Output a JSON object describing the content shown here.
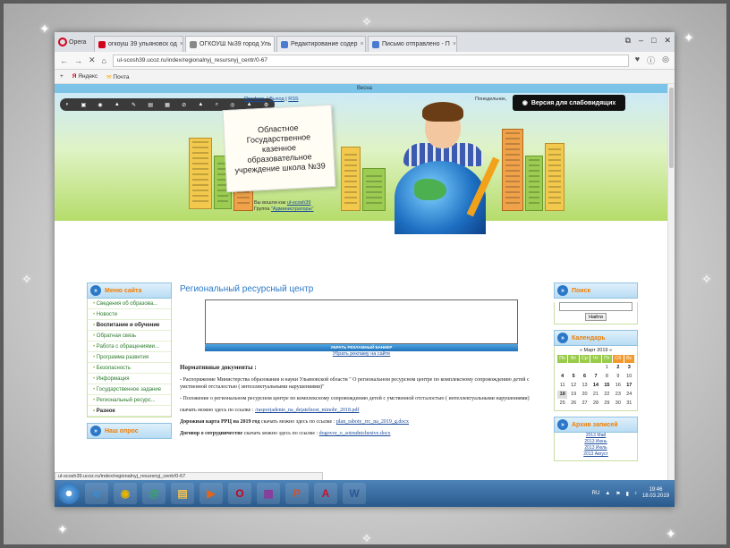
{
  "browser": {
    "menu_label": "Opera",
    "tabs": [
      {
        "label": "огкоуш 39 ульяновск од",
        "color": "#d0021b",
        "active": false
      },
      {
        "label": "ОГКОУШ №39 город Уль",
        "color": "#888888",
        "active": true
      },
      {
        "label": "Редактирование содер",
        "color": "#4a7bd0",
        "active": false
      },
      {
        "label": "Письмо отправлено - П",
        "color": "#4a7bd0",
        "active": false
      }
    ],
    "tab_close": "×",
    "window_controls": [
      "⧉",
      "–",
      "□",
      "✕"
    ],
    "nav": {
      "back": "←",
      "forward": "→",
      "stop": "✕",
      "home": "⌂"
    },
    "url": "ul-scosh39.ucoz.ru/index/regionalnyj_resursnyj_centr/0-67",
    "addr_icons": [
      "♥",
      "ⓘ",
      "◎"
    ],
    "bookmarks": [
      {
        "label": "Яндекс",
        "icon": "Я"
      },
      {
        "label": "Почта",
        "icon": "✉"
      }
    ],
    "status_url": "ul-scosh39.ucoz.ru/index/regionalnyj_resursnyj_centr/0-67"
  },
  "site": {
    "top_strip": "Весна",
    "toolbar_icons": [
      "◐",
      "▣",
      "◉",
      "▲",
      "✎",
      "▤",
      "▦",
      "⊘",
      "▲",
      "⌕",
      "◎",
      "▲",
      "⚙"
    ],
    "login_links": [
      "Профиль",
      "Выход",
      "RSS"
    ],
    "greeting": "Понедельник,",
    "impaired_label": "Версия для слабовидящих",
    "impaired_icon": "◉",
    "school_name": "Областное Государственное казенное образовательное учреждение школа №39",
    "logged_in_prefix": "Вы вошли как",
    "logged_in_user": "ul-scosh39",
    "group_prefix": "Группа",
    "group_name": "\"Администраторы\""
  },
  "left_menu": {
    "title": "Меню сайта",
    "items": [
      {
        "label": "Сведения об образова...",
        "dark": false
      },
      {
        "label": "Новости",
        "dark": false
      },
      {
        "label": "Воспитание и обучение",
        "dark": true
      },
      {
        "label": "Обратная связь",
        "dark": false
      },
      {
        "label": "Работа с обращениями...",
        "dark": false
      },
      {
        "label": "Программа развития",
        "dark": false
      },
      {
        "label": "Безопасность",
        "dark": false
      },
      {
        "label": "Информация",
        "dark": false
      },
      {
        "label": "Государственное задание",
        "dark": false
      },
      {
        "label": "Региональный ресурс...",
        "dark": false
      },
      {
        "label": "Разное",
        "dark": true
      }
    ],
    "poll_title": "Наш опрос"
  },
  "content": {
    "title": "Региональный ресурсный центр",
    "ad_button": "УБРАТЬ РЕКЛАМНЫЙ БАННЕР",
    "ad_link": "Убрать рекламу на сайте",
    "heading": "Нормативные документы :",
    "p1": "- Распоряжение Министерства образования и науки Ульяновской области \" О региональном ресурсном центре по комплексному сопровождению детей с умственной отсталостью ( интеллектуальными нарушениями)\"",
    "p2": "- Положение о региональном ресурсном центре по комплексному сопровождению детей с умственной отсталостью ( интеллектуальными нарушениями)",
    "download_prefix": "скачать можно здесь по ссылке :",
    "link1": "/rasporjadenie_na_dejatelnost_minobr_2018.pdf",
    "roadmap_label": "Дорожная карта РРЦ на 2019 год",
    "roadmap_download": "скачать можно здесь по ссылке :",
    "link2": "plan_raboty_rrc_na_2019_g.docx",
    "agreement_label": "Договор о сотрудничестве",
    "agreement_download": "скачать можно здесь по ссылке :",
    "link3": "dogovor_o_sotrudnichestve.docx"
  },
  "right_sidebar": {
    "search_title": "Поиск",
    "search_button": "Найти",
    "calendar_title": "Календарь",
    "calendar_month": "« Март 2019 »",
    "weekdays": [
      "Пн",
      "Вт",
      "Ср",
      "Чт",
      "Пт",
      "Сб",
      "Вс"
    ],
    "days": [
      "",
      "",
      "",
      "",
      "1",
      "2",
      "3",
      "4",
      "5",
      "6",
      "7",
      "8",
      "9",
      "10",
      "11",
      "12",
      "13",
      "14",
      "15",
      "16",
      "17",
      "18",
      "19",
      "20",
      "21",
      "22",
      "23",
      "24",
      "25",
      "26",
      "27",
      "28",
      "29",
      "30",
      "31"
    ],
    "bold_days": [
      "2",
      "3",
      "4",
      "5",
      "6",
      "7",
      "14",
      "15",
      "17"
    ],
    "today": "18",
    "archive_title": "Архив записей",
    "archive_items": [
      "2013 Май",
      "2013 Июнь",
      "2013 Июль",
      "2013 Август"
    ]
  },
  "taskbar": {
    "icons": [
      {
        "name": "ie",
        "glyph": "e",
        "color": "#2f8fdc"
      },
      {
        "name": "chrome",
        "glyph": "◉",
        "color": "#e8b400"
      },
      {
        "name": "mail",
        "glyph": "@",
        "color": "#2fb04a"
      },
      {
        "name": "explorer",
        "glyph": "▤",
        "color": "#f2c14e"
      },
      {
        "name": "media",
        "glyph": "▶",
        "color": "#e0661b"
      },
      {
        "name": "opera",
        "glyph": "O",
        "color": "#d0021b"
      },
      {
        "name": "winrar",
        "glyph": "▦",
        "color": "#8a3a9a"
      },
      {
        "name": "powerpoint",
        "glyph": "P",
        "color": "#d35230"
      },
      {
        "name": "pdf",
        "glyph": "A",
        "color": "#c8102e"
      },
      {
        "name": "word",
        "glyph": "W",
        "color": "#2b5797"
      }
    ],
    "lang": "RU",
    "tray_icons": [
      "▲",
      "⚑",
      "▮",
      "♪"
    ],
    "time": "19:46",
    "date": "18.03.2019"
  }
}
